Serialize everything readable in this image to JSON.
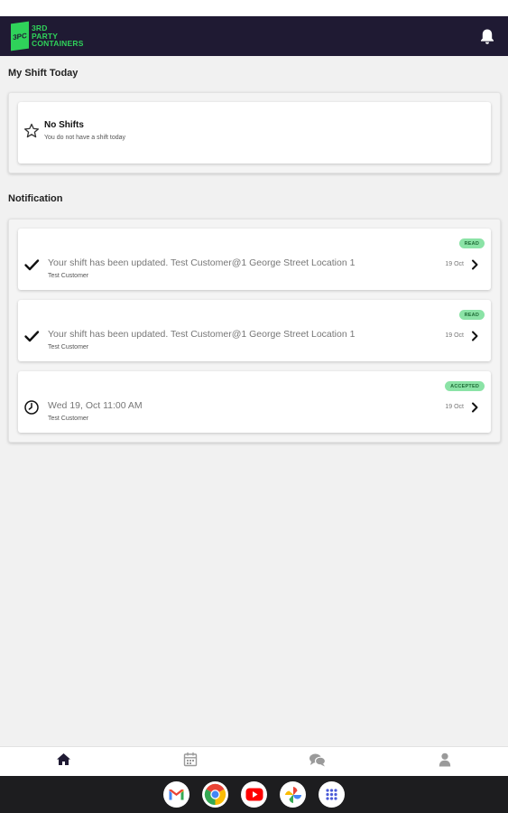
{
  "header": {
    "logo_mark": "3PC",
    "logo_lines": [
      "3RD",
      "PARTY",
      "CONTAINERS"
    ],
    "bell_icon": "bell-icon"
  },
  "shift_section": {
    "title": "My Shift Today",
    "empty_title": "No Shifts",
    "empty_subtitle": "You do not have a shift today",
    "empty_icon": "star-outline-icon"
  },
  "notification_section": {
    "title": "Notification",
    "items": [
      {
        "icon": "check-icon",
        "message": "Your shift has been updated. Test Customer@1 George Street Location 1",
        "customer": "Test Customer",
        "status": "READ",
        "date": "19 Oct"
      },
      {
        "icon": "check-icon",
        "message": "Your shift has been updated. Test Customer@1 George Street Location 1",
        "customer": "Test Customer",
        "status": "READ",
        "date": "19 Oct"
      },
      {
        "icon": "clock-icon",
        "message": "Wed 19, Oct 11:00 AM",
        "customer": "Test Customer",
        "status": "ACCEPTED",
        "date": "19 Oct"
      }
    ]
  },
  "colors": {
    "header_bg": "#1f1a33",
    "brand_green": "#2fd25a",
    "badge_bg": "#8be3a6",
    "page_bg": "#f1f1f1"
  },
  "bottom_nav": {
    "items": [
      "home-icon",
      "calendar-icon",
      "chat-icon",
      "profile-icon"
    ],
    "active": "home-icon"
  },
  "dock": {
    "apps": [
      "gmail-icon",
      "chrome-icon",
      "youtube-icon",
      "photos-icon",
      "app-drawer-icon"
    ]
  }
}
